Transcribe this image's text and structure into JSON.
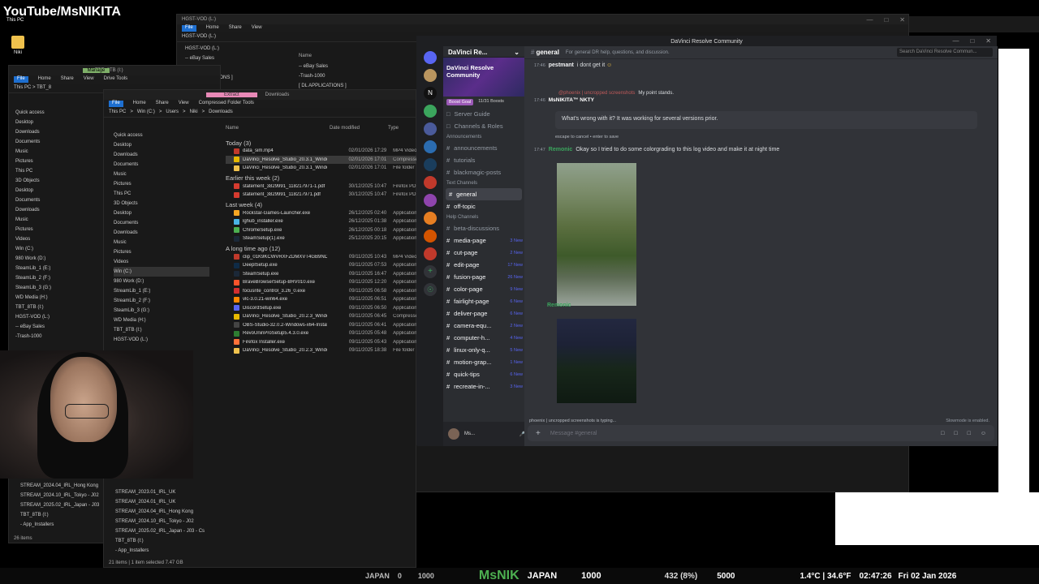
{
  "overlay": {
    "youtube_label": "YouTube/MsNIKITA"
  },
  "desktop": {
    "this_pc": "This PC",
    "icon_label": "Niki"
  },
  "explorer_back": {
    "title": "HGST-VOD (L:)",
    "ribbon": [
      "File",
      "Home",
      "Share",
      "View"
    ],
    "addr": "HGST-VOD (L:)",
    "name_col": "Name",
    "items": [
      "-- eBay Sales",
      "-Trash-1000",
      "[ DL APPLICATIONS ]"
    ],
    "tree": [
      "HGST-VOD (L:)",
      "-- eBay Sales",
      "-Trash-1000",
      "[ DL APPLICATIONS ]"
    ]
  },
  "explorer_left": {
    "title": "TBT_8TB (I:)",
    "manage": "Manage",
    "ribbon": [
      "File",
      "Home",
      "Share",
      "View",
      "Drive Tools"
    ],
    "addr": "This PC > TBT_8",
    "tree": [
      "Quick access",
      "Desktop",
      "Downloads",
      "Documents",
      "Music",
      "Pictures",
      "This PC",
      "3D Objects",
      "Desktop",
      "Documents",
      "Downloads",
      "Music",
      "Pictures",
      "Videos",
      "Win (C:)",
      "980 Work (D:)",
      "SteamLib_1 (E:)",
      "SteamLib_2 (F:)",
      "SteamLib_3 (G:)",
      "WD Media (H:)",
      "TBT_8TB (I:)",
      "HGST-VOD (L:)",
      "-- eBay Sales",
      "-Trash-1000"
    ],
    "bottom_tree": [
      "STREAM_2024.04_IRL_Hong Kong",
      "STREAM_2024.10_IRL_Tokyo - J02",
      "STREAM_2025.02_IRL_Japan - J03",
      "TBT_8TB (I:)",
      "- App_Installers"
    ],
    "status": "26 items"
  },
  "explorer_main": {
    "extract": "Extract",
    "downloads_title": "Downloads",
    "ribbon": [
      "File",
      "Home",
      "Share",
      "View",
      "Compressed Folder Tools"
    ],
    "addr": [
      "This PC",
      "Win (C:)",
      "Users",
      "Niki",
      "Downloads"
    ],
    "cols": {
      "name": "Name",
      "date": "Date modified",
      "type": "Type"
    },
    "tree": [
      "Quick access",
      "Desktop",
      "Downloads",
      "Documents",
      "Music",
      "Pictures",
      "This PC",
      "3D Objects",
      "Desktop",
      "Documents",
      "Downloads",
      "Music",
      "Pictures",
      "Videos",
      "Win (C:)",
      "980 Work (D:)",
      "StreamLib_1 (E:)",
      "StreamLib_2 (F:)",
      "SteamLib_3 (G:)",
      "WD Media (H:)",
      "TBT_8TB (I:)",
      "HGST-VOD (L:)"
    ],
    "groups": [
      {
        "label": "Today (3)",
        "files": [
          {
            "name": "data_sim.mp4",
            "date": "02/01/2026 17:29",
            "type": "MP4 Video",
            "color": "#c0392b"
          },
          {
            "name": "DaVinci_Resolve_Studio_20.3.1_Windows...",
            "date": "02/01/2026 17:01",
            "type": "Compresse",
            "color": "#e6b800",
            "sel": true
          },
          {
            "name": "DaVinci_Resolve_Studio_20.3.1_Windows",
            "date": "02/01/2026 17:01",
            "type": "File folder",
            "color": "#f0c24d"
          }
        ]
      },
      {
        "label": "Earlier this week (2)",
        "files": [
          {
            "name": "statement_3829991_118217971-1.pdf",
            "date": "30/12/2025 10:47",
            "type": "Firefox PDF",
            "color": "#d63b2f"
          },
          {
            "name": "statement_3829991_118217971.pdf",
            "date": "30/12/2025 10:47",
            "type": "Firefox PDF",
            "color": "#d63b2f"
          }
        ]
      },
      {
        "label": "Last week (4)",
        "files": [
          {
            "name": "Rockstar-Games-Launcher.exe",
            "date": "26/12/2025 02:40",
            "type": "Application",
            "color": "#f5a623"
          },
          {
            "name": "lghub_installer.exe",
            "date": "26/12/2025 01:38",
            "type": "Application",
            "color": "#4ab3e6"
          },
          {
            "name": "ChromeSetup.exe",
            "date": "26/12/2025 00:18",
            "type": "Application",
            "color": "#4caf50"
          },
          {
            "name": "SteamSetup(1).exe",
            "date": "25/12/2025 20:15",
            "type": "Application",
            "color": "#1b2838"
          }
        ]
      },
      {
        "label": "A long time ago (12)",
        "files": [
          {
            "name": "clip_01K9KCWVRXFZDMXVT4GB9NDD041...",
            "date": "09/11/2025 10:43",
            "type": "MP4 Video",
            "color": "#c0392b"
          },
          {
            "name": "DeeplSetup.exe",
            "date": "09/11/2025 07:53",
            "type": "Application",
            "color": "#0f2b46"
          },
          {
            "name": "SteamSetup.exe",
            "date": "09/11/2025 16:47",
            "type": "Application",
            "color": "#1b2838"
          },
          {
            "name": "BraveBrowserSetup-BRV010.exe",
            "date": "09/11/2025 12:20",
            "type": "Application",
            "color": "#fb542b"
          },
          {
            "name": "focusrite_control_3.26_0.exe",
            "date": "09/11/2025 06:58",
            "type": "Application",
            "color": "#d32f2f"
          },
          {
            "name": "vlc-3.0.21-win64.exe",
            "date": "09/11/2025 06:51",
            "type": "Application",
            "color": "#ff8800"
          },
          {
            "name": "DiscordSetup.exe",
            "date": "09/11/2025 06:50",
            "type": "Application",
            "color": "#5865f2"
          },
          {
            "name": "DaVinci_Resolve_Studio_20.2.3_Windows...",
            "date": "09/11/2025 06:45",
            "type": "Compresse",
            "color": "#e6b800"
          },
          {
            "name": "OBS-Studio-32.0.2-Windows-x64-Installe...",
            "date": "09/11/2025 06:41",
            "type": "Application",
            "color": "#444"
          },
          {
            "name": "RevoUninProSetup5.4.3.0.exe",
            "date": "09/11/2025 05:48",
            "type": "Application",
            "color": "#2e7d32"
          },
          {
            "name": "Firefox Installer.exe",
            "date": "09/11/2025 05:43",
            "type": "Application",
            "color": "#ff7139"
          },
          {
            "name": "DaVinci_Resolve_Studio_20.2.3_Windows",
            "date": "09/11/2025 18:38",
            "type": "File folder",
            "color": "#f0c24d"
          }
        ]
      }
    ],
    "bottom_tree": [
      "STREAM_2023.01_IRL_UK",
      "STREAM_2024.01_IRL_UK",
      "STREAM_2024.04_IRL_Hong Kong",
      "STREAM_2024.10_IRL_Tokyo - J02",
      "STREAM_2025.02_IRL_Japan - J03 - Cs",
      "TBT_8TB (I:)",
      "- App_Installers"
    ],
    "status": "21 items  |  1 item selected  7.47 GB"
  },
  "discord": {
    "window_title": "DaVinci Resolve Community",
    "server_name": "DaVinci Re...",
    "banner": "DaVinci Resolve Community",
    "boost_goal": "Boost Goal",
    "boosts": "11/31 Boosts",
    "nav": [
      "Server Guide",
      "Channels & Roles"
    ],
    "categories": {
      "announcements": "Announcements",
      "text": "Text Channels",
      "help": "Help Channels"
    },
    "ann_channels": [
      "announcements",
      "tutorials",
      "blackmagic-posts"
    ],
    "text_channels": [
      "general",
      "off-topic"
    ],
    "help_channels": [
      {
        "name": "beta-discussions",
        "new": ""
      },
      {
        "name": "media-page",
        "new": "3 New"
      },
      {
        "name": "cut-page",
        "new": "2 New"
      },
      {
        "name": "edit-page",
        "new": "17 New"
      },
      {
        "name": "fusion-page",
        "new": "26 New"
      },
      {
        "name": "color-page",
        "new": "9 New"
      },
      {
        "name": "fairlight-page",
        "new": "6 New"
      },
      {
        "name": "deliver-page",
        "new": "6 New"
      },
      {
        "name": "camera-equ...",
        "new": "2 New"
      },
      {
        "name": "computer-h...",
        "new": "4 New"
      },
      {
        "name": "linux-only-q...",
        "new": "5 New"
      },
      {
        "name": "motion-grap...",
        "new": "1 New"
      },
      {
        "name": "quick-tips",
        "new": "6 New"
      },
      {
        "name": "recreate-in-...",
        "new": "3 New"
      }
    ],
    "channel_name": "general",
    "channel_topic": "For general DR help, questions, and discussion.",
    "search_placeholder": "Search DaVinci Resolve Commun...",
    "messages": [
      {
        "time": "17:46",
        "user": "pestmant",
        "text": "i dont get it"
      },
      {
        "time": "",
        "user": "@phoenix | uncropped screenshots",
        "text": "My point stands."
      },
      {
        "time": "17:46",
        "user": "MsNIKITA™ NKTY",
        "text": ""
      },
      {
        "time": "17:47",
        "user": "Remonic",
        "text": "Okay so I tried to do some colorgrading to this log video and make it at night time"
      },
      {
        "time": "",
        "user": "Remonic",
        "text": ""
      }
    ],
    "edit_text": "What's wrong with it? It was working for several versions prior.",
    "edit_hint": "escape to cancel • enter to save",
    "typing": "phoenix | uncropped screenshots is typing...",
    "slowmode": "Slowmode is enabled.",
    "compose_placeholder": "Message #general",
    "user": "Ms..."
  },
  "bottom_bar": {
    "left": "JAPAN",
    "stat1": "0",
    "stat2": "1000",
    "brand": "MsNIK",
    "goal": "JAPAN",
    "goal_val": "1000",
    "stat3": "432 (8%)",
    "stat4": "5000",
    "weather": "1.4°C | 34.6°F",
    "time": "02:47:26",
    "date": "Fri 02 Jan 2026"
  }
}
